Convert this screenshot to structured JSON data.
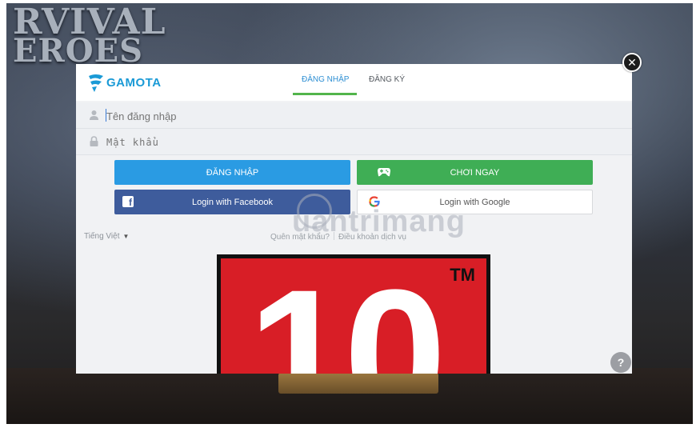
{
  "background": {
    "game_title_line1": "RVIVAL",
    "game_title_line2": "EROES"
  },
  "header": {
    "logo_text": "GAMOTA",
    "tabs": [
      {
        "label": "ĐĂNG NHẬP",
        "active": true
      },
      {
        "label": "ĐĂNG KÝ",
        "active": false
      }
    ]
  },
  "form": {
    "username_placeholder": "Tên đăng nhập",
    "password_placeholder": "Mật khẩu",
    "login_button": "ĐĂNG NHẬP",
    "play_now_button": "CHƠI NGAY",
    "facebook_button": "Login with Facebook",
    "google_button": "Login with Google"
  },
  "footer": {
    "language": "Tiếng Việt",
    "forgot_password": "Quên mật khẩu?",
    "terms": "Điều khoản dịch vụ"
  },
  "rating_badge": {
    "number": "10",
    "trademark": "TM"
  },
  "watermark": "uantrimang",
  "colors": {
    "brand": "#1a9ad6",
    "login_blue": "#2a9be3",
    "play_green": "#3fae55",
    "facebook": "#3e5c9c",
    "tab_underline": "#52b54b",
    "rating_red": "#d81e26"
  },
  "icons": {
    "close": "close-icon",
    "help": "help-icon",
    "user": "user-icon",
    "lock": "lock-icon",
    "gamepad": "gamepad-icon",
    "facebook": "facebook-icon",
    "google": "google-icon"
  }
}
